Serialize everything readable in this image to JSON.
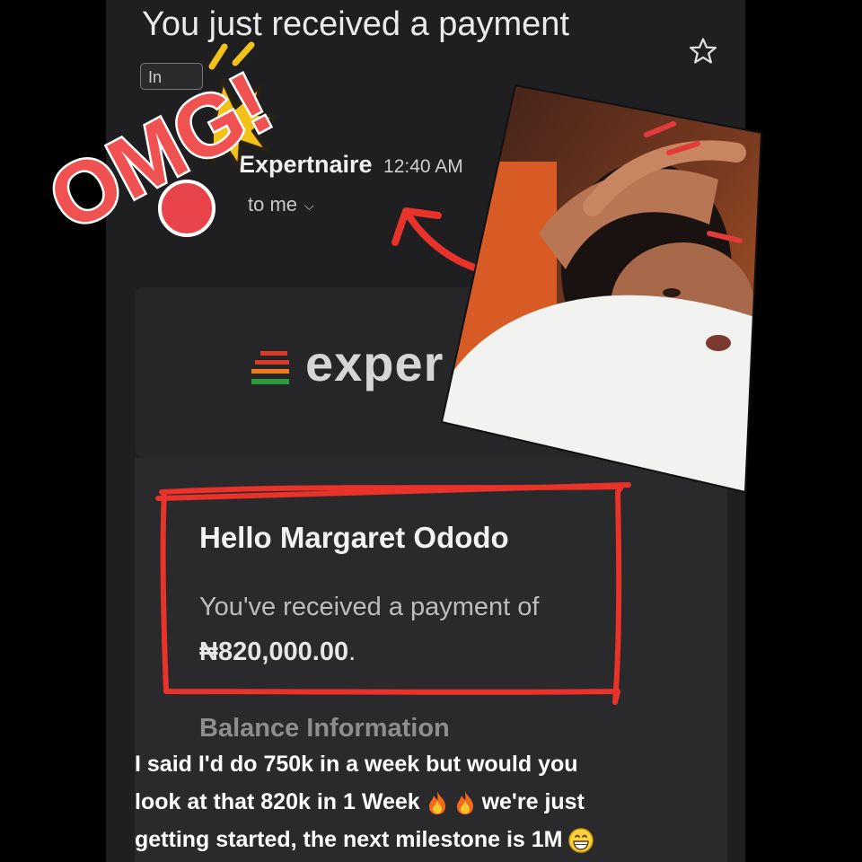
{
  "email": {
    "subject": "You just received a payment",
    "label_chip": "In",
    "sender_name": "Expertnaire",
    "time": "12:40 AM",
    "recipient": "to me",
    "brand_name": "exper",
    "greeting": "Hello Margaret Ododo",
    "payment_text": "You've received a payment of",
    "amount": "₦820,000.00",
    "amount_suffix": ".",
    "balance_heading": "Balance Information"
  },
  "stickers": {
    "omg": "OMG!"
  },
  "caption": {
    "line1": "I said I'd do 750k in a week but would you",
    "line2a": "look at that 820k in 1 Week",
    "line2b": "we're just",
    "line3": "getting started, the next milestone is 1M"
  },
  "icons": [
    "star-icon",
    "chevron-down-icon",
    "fire-icon",
    "grin-icon"
  ],
  "colors": {
    "background": "#000000",
    "screen": "#1f1f21",
    "annotation_red": "#e8322a",
    "logo_red": "#d93a26",
    "logo_orange": "#ef7a1a",
    "logo_green": "#2e9a3c"
  }
}
